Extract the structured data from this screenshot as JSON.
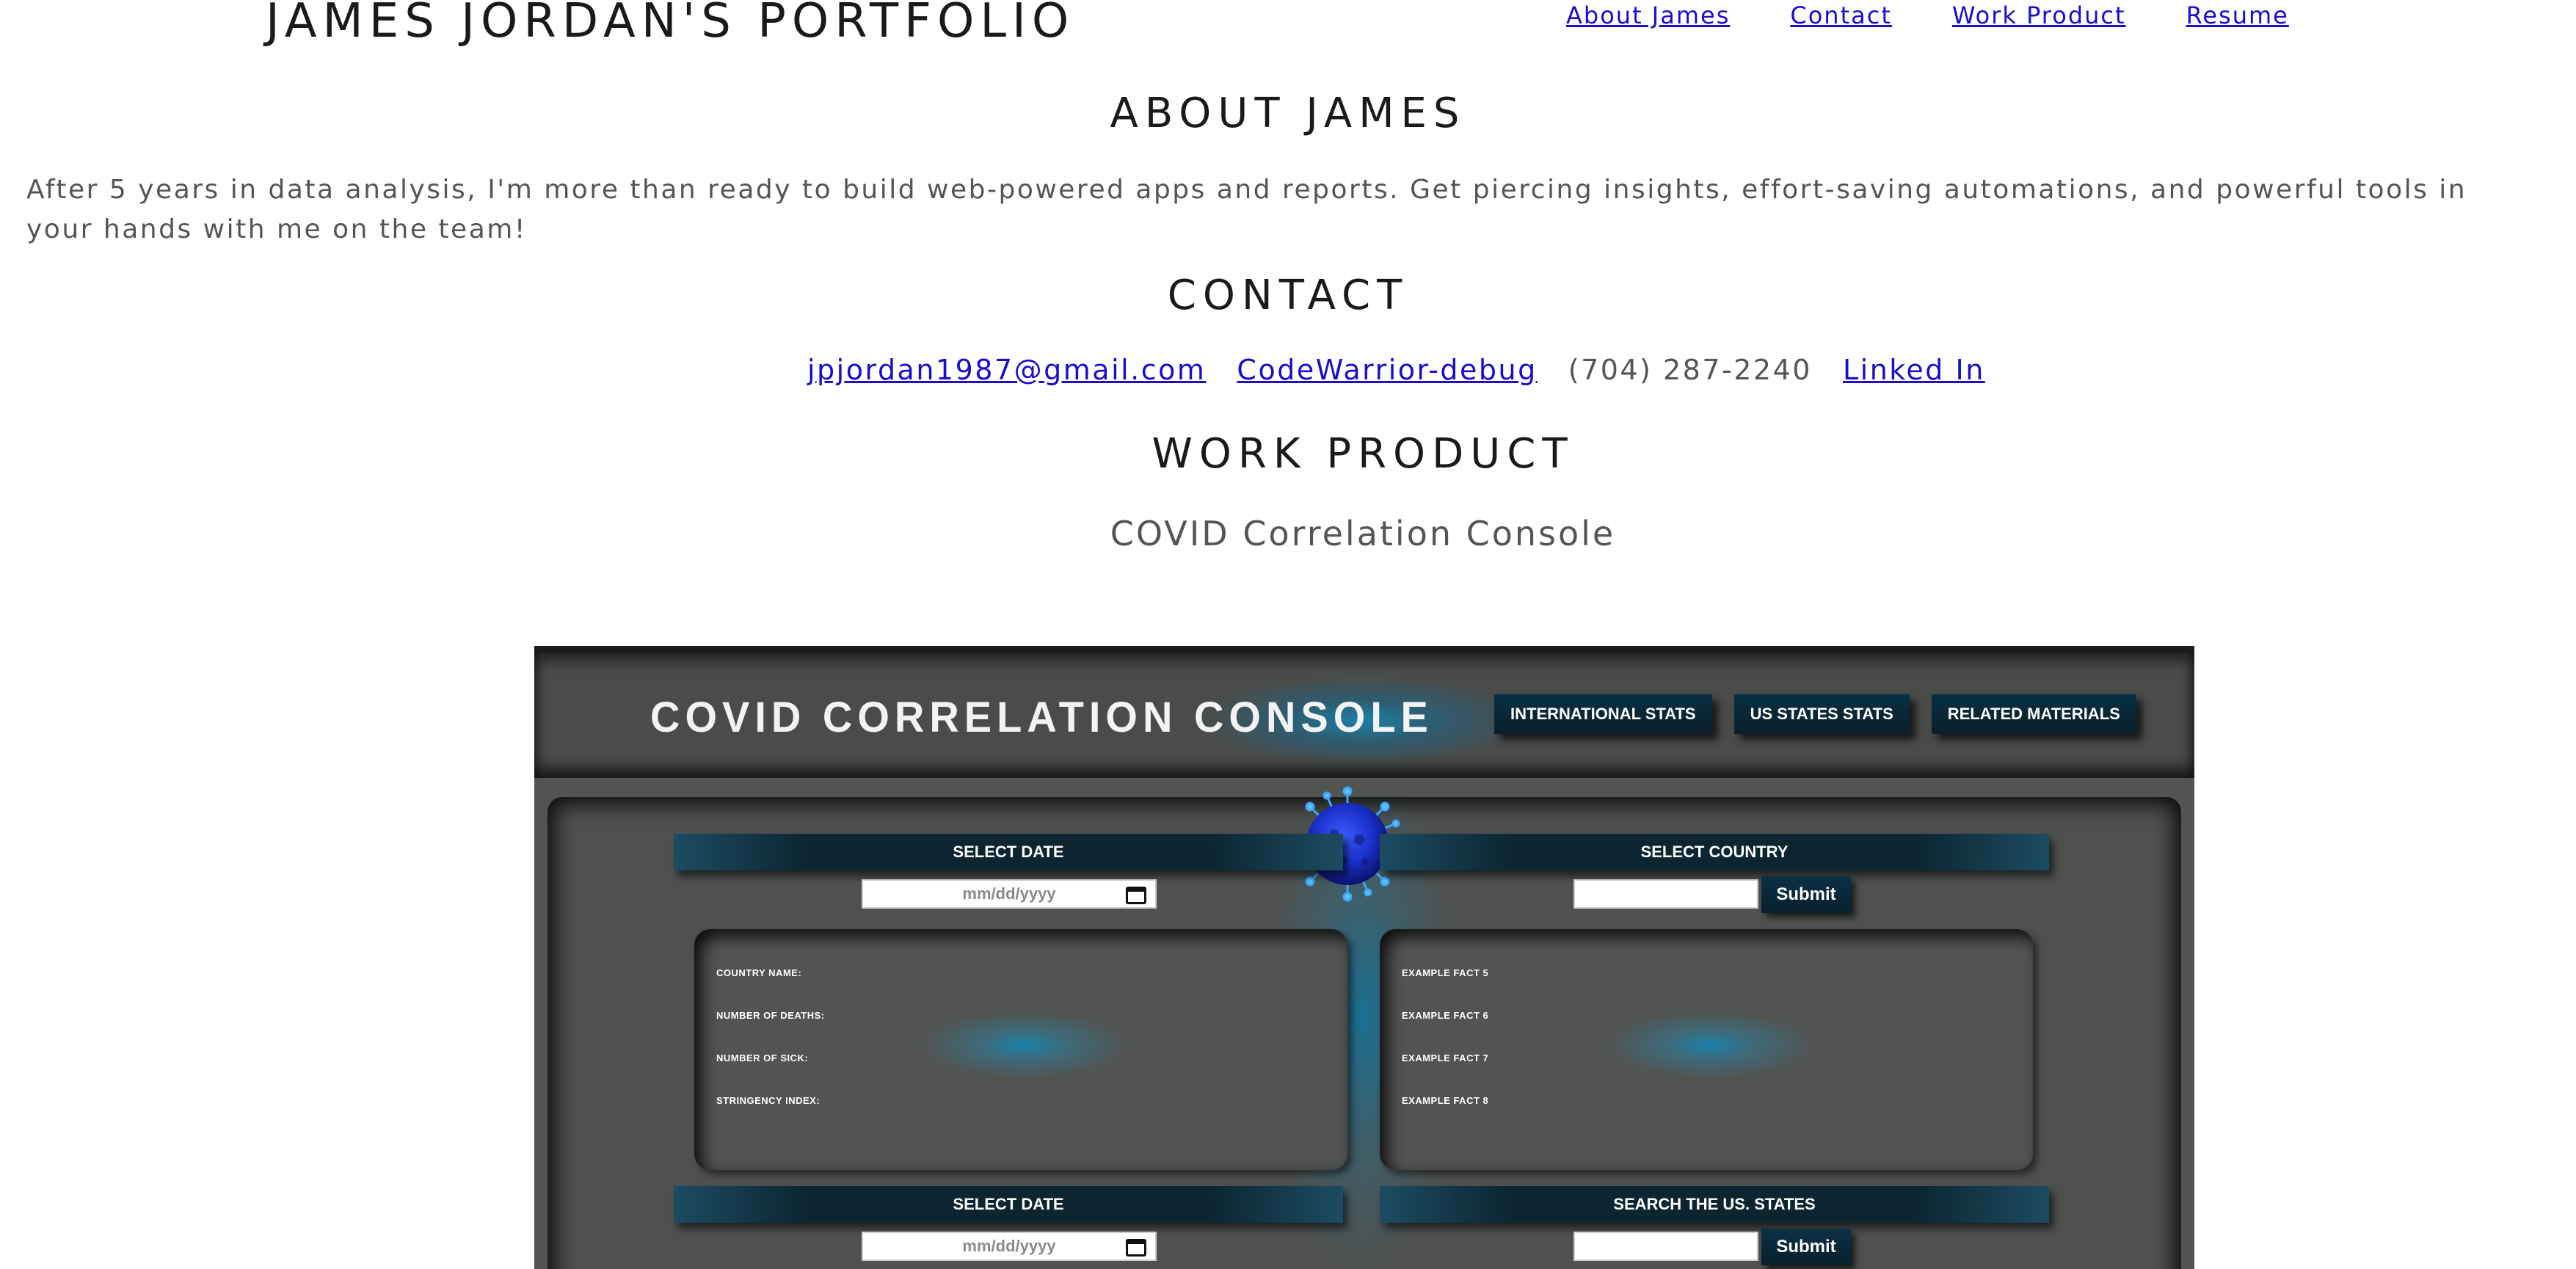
{
  "header": {
    "site_title": "JAMES JORDAN'S PORTFOLIO",
    "nav": [
      "About James",
      "Contact",
      "Work Product",
      "Resume"
    ]
  },
  "about": {
    "heading": "ABOUT JAMES",
    "text": "After 5 years in data analysis, I'm more than ready to build web-powered apps and reports. Get piercing insights, effort-saving automations, and powerful tools in your hands with me on the team!"
  },
  "contact": {
    "heading": "CONTACT",
    "email": "jpjordan1987@gmail.com",
    "github": "CodeWarrior-debug",
    "phone": "(704) 287-2240",
    "linkedin": "Linked In"
  },
  "work": {
    "heading": "WORK PRODUCT",
    "project_title": "COVID Correlation Console"
  },
  "console": {
    "title": "COVID CORRELATION CONSOLE",
    "nav": [
      "INTERNATIONAL STATS",
      "US STATES STATS",
      "RELATED MATERIALS"
    ],
    "select_date_label": "SELECT DATE",
    "select_country_label": "SELECT COUNTRY",
    "search_states_label": "SEARCH THE US. STATES",
    "date_placeholder": "mm/dd/yyyy",
    "submit_label": "Submit",
    "left_facts": [
      "COUNTRY NAME:",
      "NUMBER OF DEATHS:",
      "NUMBER OF SICK:",
      "STRINGENCY INDEX:"
    ],
    "right_facts": [
      "EXAMPLE FACT 5",
      "EXAMPLE FACT 6",
      "EXAMPLE FACT 7",
      "EXAMPLE FACT 8"
    ],
    "icon": "virus-icon"
  }
}
